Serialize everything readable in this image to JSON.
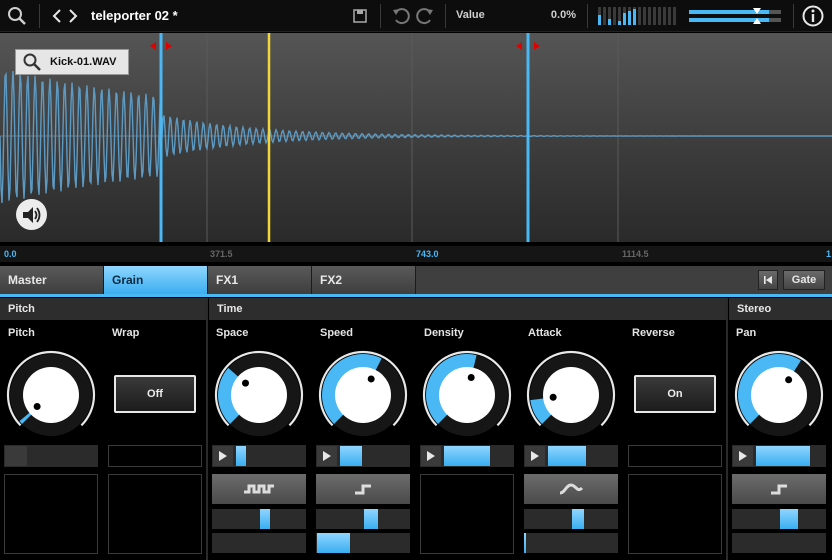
{
  "toolbar": {
    "preset_name": "teleporter 02 *",
    "value_label": "Value",
    "value_num": "0.0%"
  },
  "waveform": {
    "file_name": "Kick-01.WAV",
    "ruler": [
      "0.0",
      "371.5",
      "743.0",
      "1114.5",
      "1"
    ]
  },
  "tabs": [
    "Master",
    "Grain",
    "FX1",
    "FX2"
  ],
  "active_tab": "Grain",
  "gate_label": "Gate",
  "sections": {
    "pitch": "Pitch",
    "time": "Time",
    "stereo": "Stereo"
  },
  "controls": {
    "pitch": {
      "label": "Pitch",
      "value": 0.02
    },
    "wrap": {
      "label": "Wrap",
      "state": "Off"
    },
    "space": {
      "label": "Space",
      "value": 0.32
    },
    "speed": {
      "label": "Speed",
      "value": 0.6
    },
    "density": {
      "label": "Density",
      "value": 0.55
    },
    "attack": {
      "label": "Attack",
      "value": 0.14
    },
    "reverse": {
      "label": "Reverse",
      "state": "On"
    },
    "pan": {
      "label": "Pan",
      "value": 0.62
    }
  },
  "colors": {
    "accent": "#4ab8f5",
    "marker_yellow": "#f2d63a",
    "marker_blue": "#4ab8f5",
    "arrow_red": "#e00000"
  }
}
